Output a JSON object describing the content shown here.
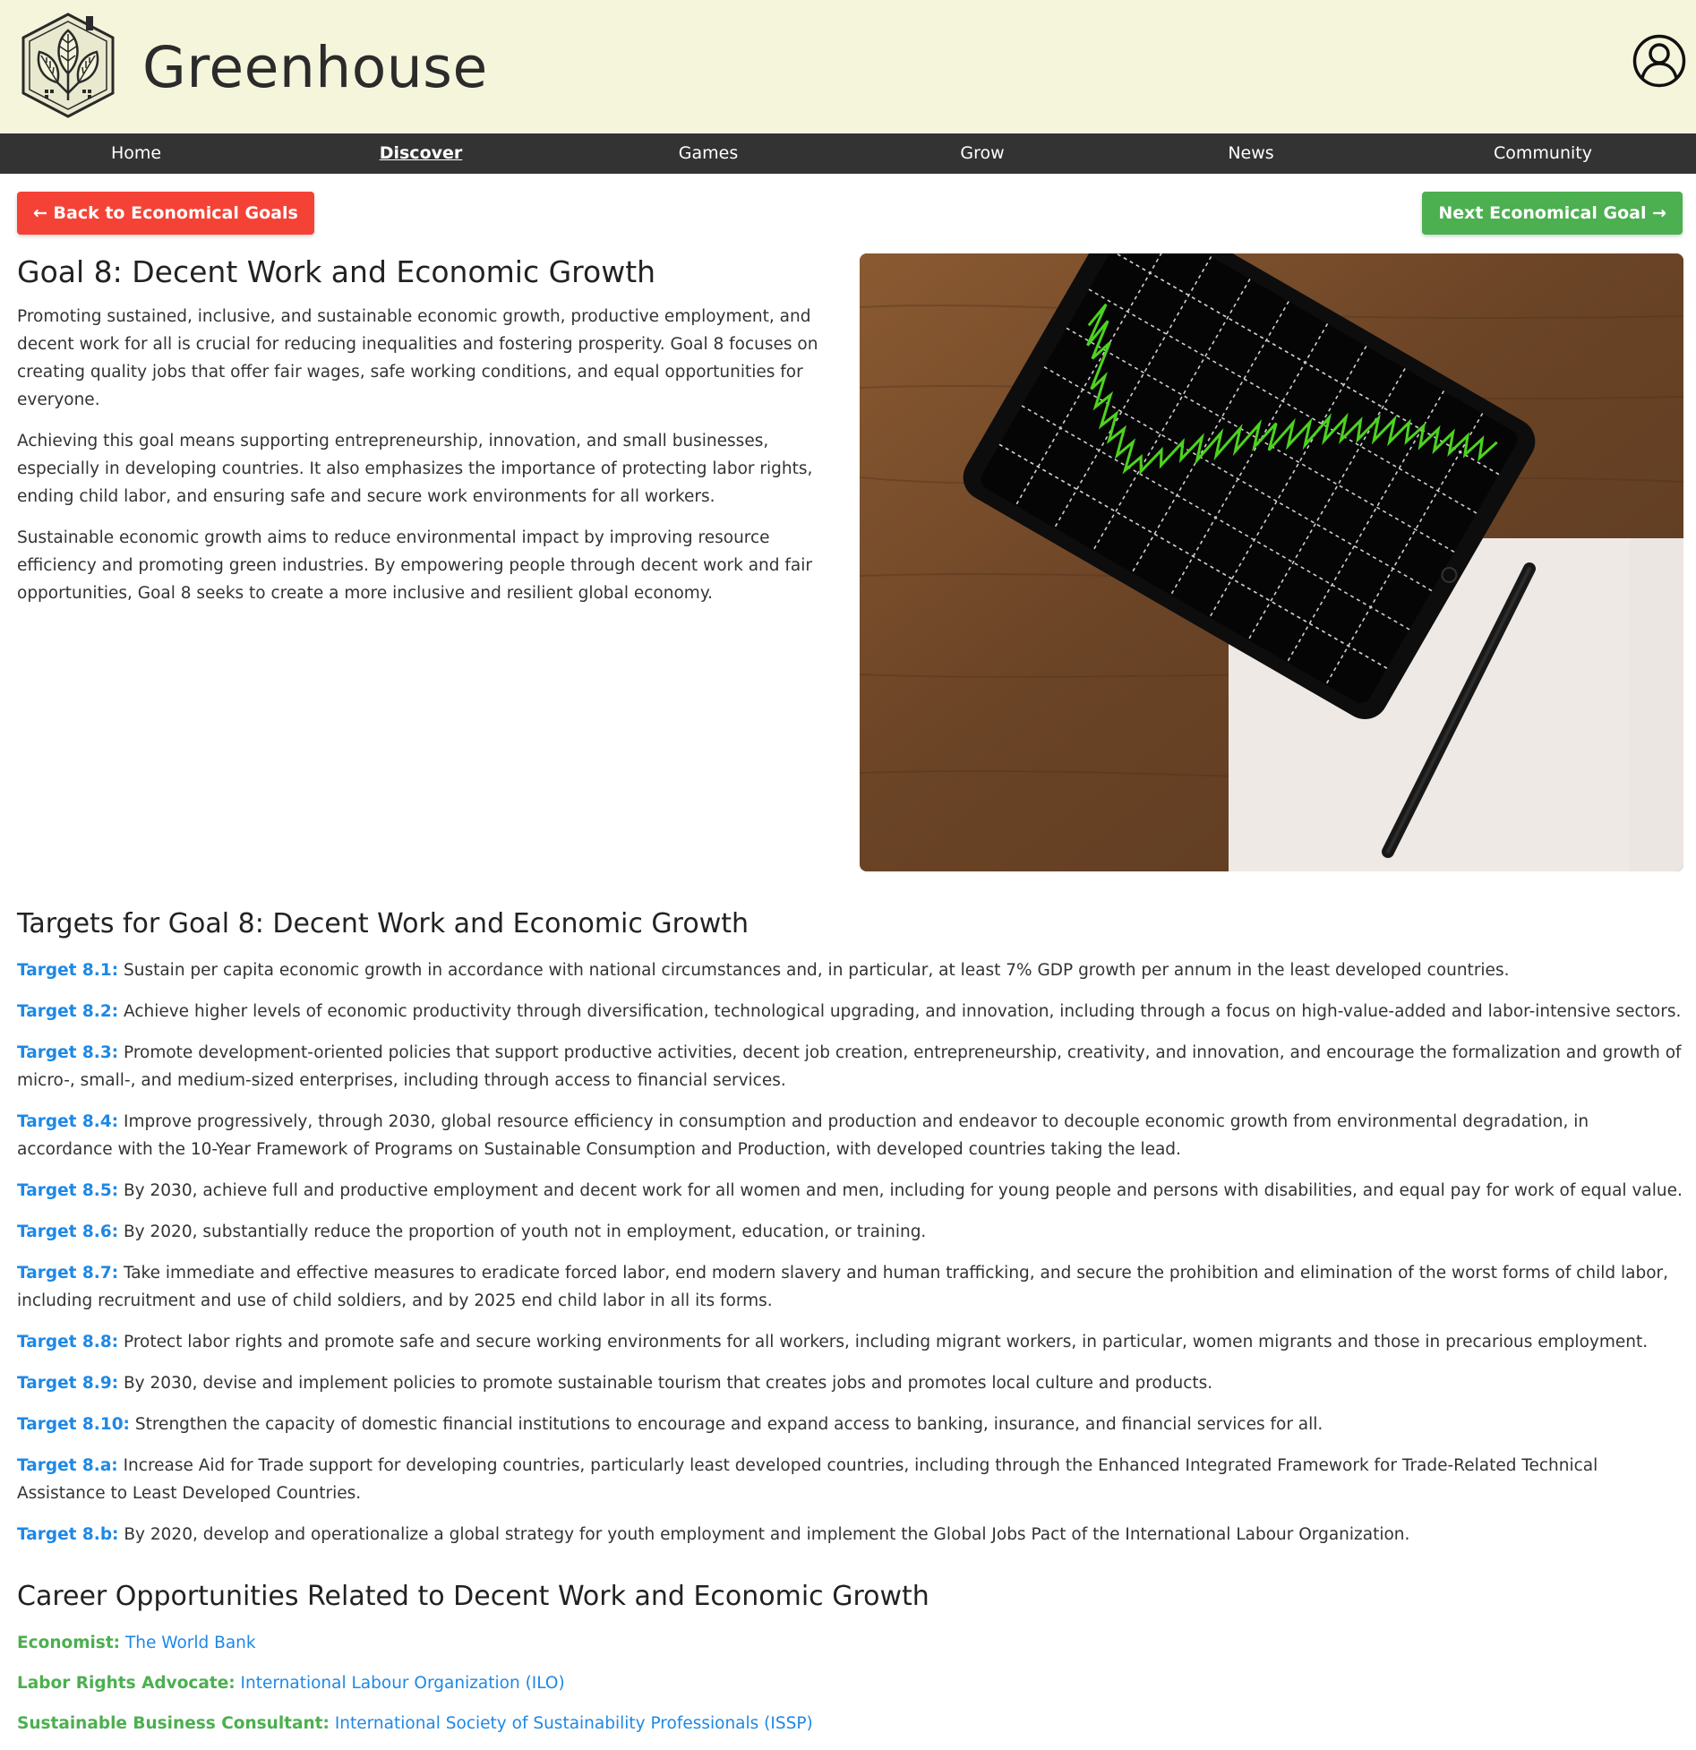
{
  "header": {
    "site_title": "Greenhouse",
    "logo_icon": "leaf-house-logo-icon",
    "profile_icon": "user-profile-icon"
  },
  "nav": {
    "items": [
      {
        "label": "Home",
        "active": false
      },
      {
        "label": "Discover",
        "active": true
      },
      {
        "label": "Games",
        "active": false
      },
      {
        "label": "Grow",
        "active": false
      },
      {
        "label": "News",
        "active": false
      },
      {
        "label": "Community",
        "active": false
      }
    ]
  },
  "buttons": {
    "back_label": "← Back to Economical Goals",
    "next_label": "Next Economical Goal →"
  },
  "goal": {
    "title": "Goal 8: Decent Work and Economic Growth",
    "paragraphs": [
      "Promoting sustained, inclusive, and sustainable economic growth, productive employment, and decent work for all is crucial for reducing inequalities and fostering prosperity. Goal 8 focuses on creating quality jobs that offer fair wages, safe working conditions, and equal opportunities for everyone.",
      "Achieving this goal means supporting entrepreneurship, innovation, and small businesses, especially in developing countries. It also emphasizes the importance of protecting labor rights, ending child labor, and ensuring safe and secure work environments for all workers.",
      "Sustainable economic growth aims to reduce environmental impact by improving resource efficiency and promoting green industries. By empowering people through decent work and fair opportunities, Goal 8 seeks to create a more inclusive and resilient global economy."
    ]
  },
  "targets": {
    "title": "Targets for Goal 8: Decent Work and Economic Growth",
    "items": [
      {
        "label": "Target 8.1:",
        "text": "Sustain per capita economic growth in accordance with national circumstances and, in particular, at least 7% GDP growth per annum in the least developed countries."
      },
      {
        "label": "Target 8.2:",
        "text": "Achieve higher levels of economic productivity through diversification, technological upgrading, and innovation, including through a focus on high-value-added and labor-intensive sectors."
      },
      {
        "label": "Target 8.3:",
        "text": "Promote development-oriented policies that support productive activities, decent job creation, entrepreneurship, creativity, and innovation, and encourage the formalization and growth of micro-, small-, and medium-sized enterprises, including through access to financial services."
      },
      {
        "label": "Target 8.4:",
        "text": "Improve progressively, through 2030, global resource efficiency in consumption and production and endeavor to decouple economic growth from environmental degradation, in accordance with the 10-Year Framework of Programs on Sustainable Consumption and Production, with developed countries taking the lead."
      },
      {
        "label": "Target 8.5:",
        "text": "By 2030, achieve full and productive employment and decent work for all women and men, including for young people and persons with disabilities, and equal pay for work of equal value."
      },
      {
        "label": "Target 8.6:",
        "text": "By 2020, substantially reduce the proportion of youth not in employment, education, or training."
      },
      {
        "label": "Target 8.7:",
        "text": "Take immediate and effective measures to eradicate forced labor, end modern slavery and human trafficking, and secure the prohibition and elimination of the worst forms of child labor, including recruitment and use of child soldiers, and by 2025 end child labor in all its forms."
      },
      {
        "label": "Target 8.8:",
        "text": "Protect labor rights and promote safe and secure working environments for all workers, including migrant workers, in particular, women migrants and those in precarious employment."
      },
      {
        "label": "Target 8.9:",
        "text": "By 2030, devise and implement policies to promote sustainable tourism that creates jobs and promotes local culture and products."
      },
      {
        "label": "Target 8.10:",
        "text": "Strengthen the capacity of domestic financial institutions to encourage and expand access to banking, insurance, and financial services for all."
      },
      {
        "label": "Target 8.a:",
        "text": "Increase Aid for Trade support for developing countries, particularly least developed countries, including through the Enhanced Integrated Framework for Trade-Related Technical Assistance to Least Developed Countries."
      },
      {
        "label": "Target 8.b:",
        "text": "By 2020, develop and operationalize a global strategy for youth employment and implement the Global Jobs Pact of the International Labour Organization."
      }
    ]
  },
  "careers": {
    "title": "Career Opportunities Related to Decent Work and Economic Growth",
    "items": [
      {
        "role": "Economist:",
        "org": "The World Bank"
      },
      {
        "role": "Labor Rights Advocate:",
        "org": "International Labour Organization (ILO)"
      },
      {
        "role": "Sustainable Business Consultant:",
        "org": "International Society of Sustainability Professionals (ISSP)"
      }
    ]
  },
  "colors": {
    "header_bg": "#f5f5dc",
    "nav_bg": "#333333",
    "back_button": "#f44336",
    "next_button": "#4caf50",
    "target_label": "#1e88e5",
    "career_label": "#4caf50",
    "career_link": "#1e88e5"
  },
  "hero_image": {
    "icon": "tablet-stock-chart-photo"
  }
}
